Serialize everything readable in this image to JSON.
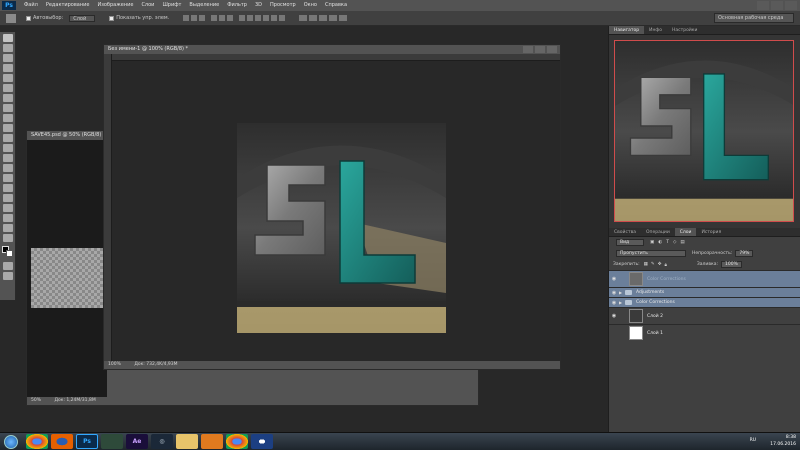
{
  "menubar": {
    "app_logo": "Ps",
    "items": [
      "Файл",
      "Редактирование",
      "Изображение",
      "Слои",
      "Шрифт",
      "Выделение",
      "Фильтр",
      "3D",
      "Просмотр",
      "Окно",
      "Справка"
    ]
  },
  "options_bar": {
    "autoselect_label": "Автовыбор:",
    "autoselect_target": "Слой",
    "show_controls_label": "Показать упр. элем.",
    "workspace": "Основная рабочая среда"
  },
  "doc_back": {
    "title": "SAVE45.psd @ 50% (RGB/8)",
    "zoom": "50%",
    "doc_size": "Док: 1,24M/31,8M"
  },
  "doc_front": {
    "title": "Без имени-1 @ 100% (RGB/8) *",
    "zoom": "100%",
    "doc_size": "Док: 732,4K/4,93M"
  },
  "artwork": {
    "letters": [
      "S",
      "L"
    ],
    "colors": {
      "s_letter": "#8d8d8d",
      "l_letter": "#1f8a83",
      "arch": "#3c3c3c",
      "floor": "#c8b47a"
    }
  },
  "navigator": {
    "tabs": [
      "Навигатор",
      "Инфо",
      "Настройки"
    ]
  },
  "layers": {
    "tabs_top": [
      "Свойства",
      "Операции",
      "Слои",
      "История"
    ],
    "active_tab": "Слои",
    "kind_filter": "Вид",
    "blend_mode": "Пропустить",
    "opacity_label": "Непрозрачность:",
    "opacity_value": "79%",
    "lock_label": "Закрепить:",
    "fill_label": "Заливка:",
    "fill_value": "100%",
    "rows": [
      {
        "name": "Color Corrections",
        "type": "group",
        "selected": true
      },
      {
        "name": "Adjustments",
        "type": "group",
        "selected": true
      },
      {
        "name": "Color Corrections",
        "type": "group",
        "selected": true
      },
      {
        "name": "Слой 2",
        "type": "layer",
        "selected": false
      },
      {
        "name": "Слой 1",
        "type": "layer",
        "selected": false
      }
    ]
  },
  "taskbar": {
    "apps": [
      "chrome",
      "firefox",
      "photoshop",
      "media",
      "after-effects",
      "steam",
      "explorer",
      "media-player",
      "chrome-2",
      "cinema4d"
    ],
    "lang": "RU",
    "time": "8:38",
    "date": "17.06.2016"
  }
}
